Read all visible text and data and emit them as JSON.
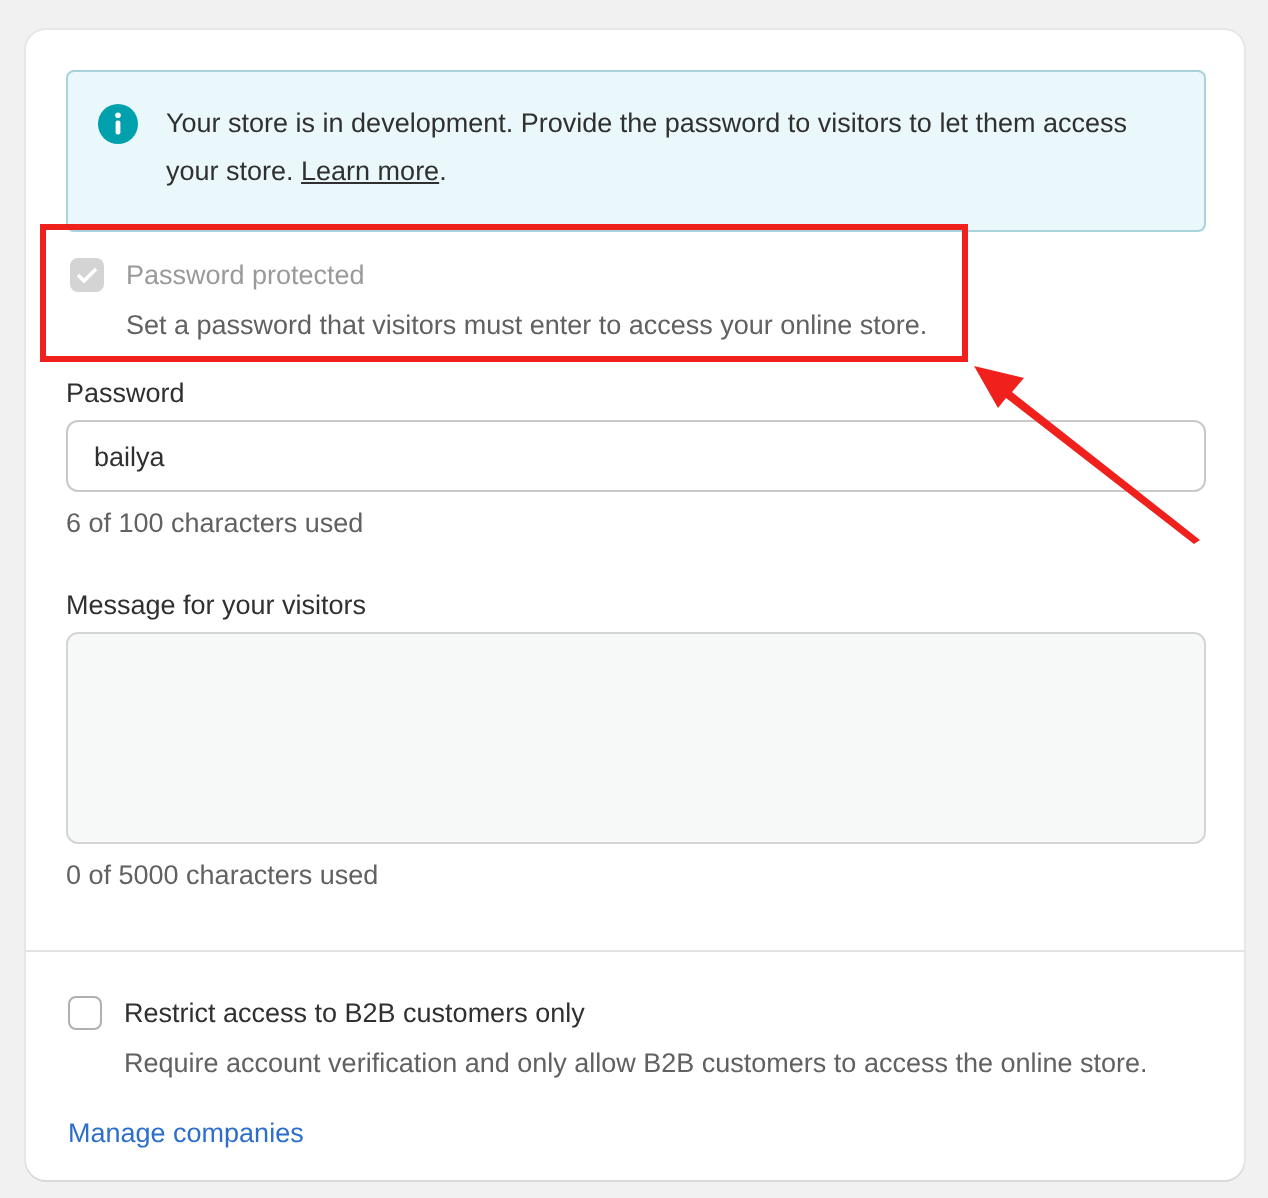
{
  "banner": {
    "text": "Your store is in development. Provide the password to visitors to let them access your store. ",
    "link": "Learn more",
    "text_after": "."
  },
  "password_protection": {
    "label": "Password protected",
    "checked": true,
    "disabled": true,
    "description": "Set a password that visitors must enter to access your online store."
  },
  "password": {
    "label": "Password",
    "value": "bailya",
    "counter": "6 of 100 characters used"
  },
  "message": {
    "label": "Message for your visitors",
    "disabled": true,
    "counter": "0 of 5000 characters used"
  },
  "b2b": {
    "label": "Restrict access to B2B customers only",
    "checked": false,
    "description": "Require account verification and only allow B2B customers to access the online store.",
    "link": "Manage companies"
  }
}
